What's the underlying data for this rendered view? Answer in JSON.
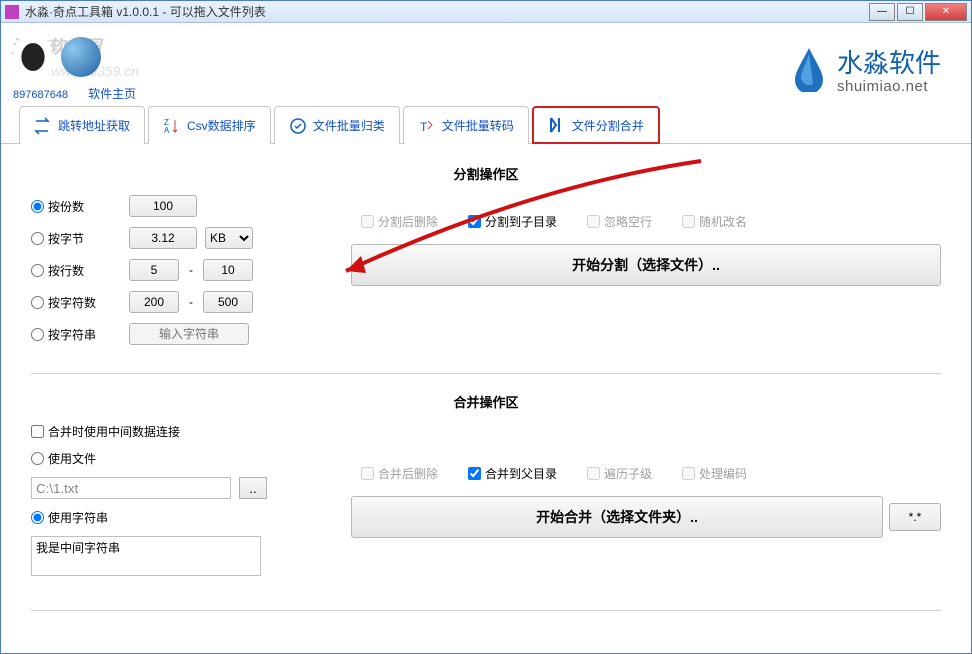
{
  "titlebar": {
    "title": "水淼·奇点工具箱 v1.0.0.1 - 可以拖入文件列表"
  },
  "watermark": {
    "site_name": "河东软件园",
    "site_url": "www.pc0359.cn"
  },
  "header": {
    "qq_number": "897687648",
    "software_home": "软件主页"
  },
  "brand": {
    "cn": "水淼软件",
    "en": "shuimiao.net"
  },
  "tabs": [
    {
      "label": "跳转地址获取",
      "icon": "redirect-icon"
    },
    {
      "label": "Csv数据排序",
      "icon": "sort-icon"
    },
    {
      "label": "文件批量归类",
      "icon": "classify-icon"
    },
    {
      "label": "文件批量转码",
      "icon": "transcode-icon"
    },
    {
      "label": "文件分割合并",
      "icon": "split-merge-icon"
    }
  ],
  "split_section": {
    "title": "分割操作区",
    "options": {
      "by_count": {
        "label": "按份数",
        "value": "100"
      },
      "by_bytes": {
        "label": "按字节",
        "value": "3.12",
        "unit": "KB"
      },
      "by_lines": {
        "label": "按行数",
        "from": "5",
        "to": "10"
      },
      "by_chars": {
        "label": "按字符数",
        "from": "200",
        "to": "500"
      },
      "by_string": {
        "label": "按字符串",
        "placeholder": "输入字符串"
      }
    },
    "checks": {
      "delete_after": "分割后删除",
      "to_subdir": "分割到子目录",
      "skip_empty": "忽略空行",
      "random_rename": "随机改名"
    },
    "button": "开始分割（选择文件）.."
  },
  "merge_section": {
    "title": "合并操作区",
    "use_middle_data": "合并时使用中间数据连接",
    "use_file": {
      "label": "使用文件",
      "path": "C:\\1.txt"
    },
    "use_string": {
      "label": "使用字符串",
      "value": "我是中间字符串"
    },
    "checks": {
      "delete_after": "合并后删除",
      "to_parent": "合并到父目录",
      "traverse_sub": "遍历子级",
      "handle_encoding": "处理编码"
    },
    "button": "开始合并（选择文件夹）..",
    "ext_filter": "*.*"
  }
}
